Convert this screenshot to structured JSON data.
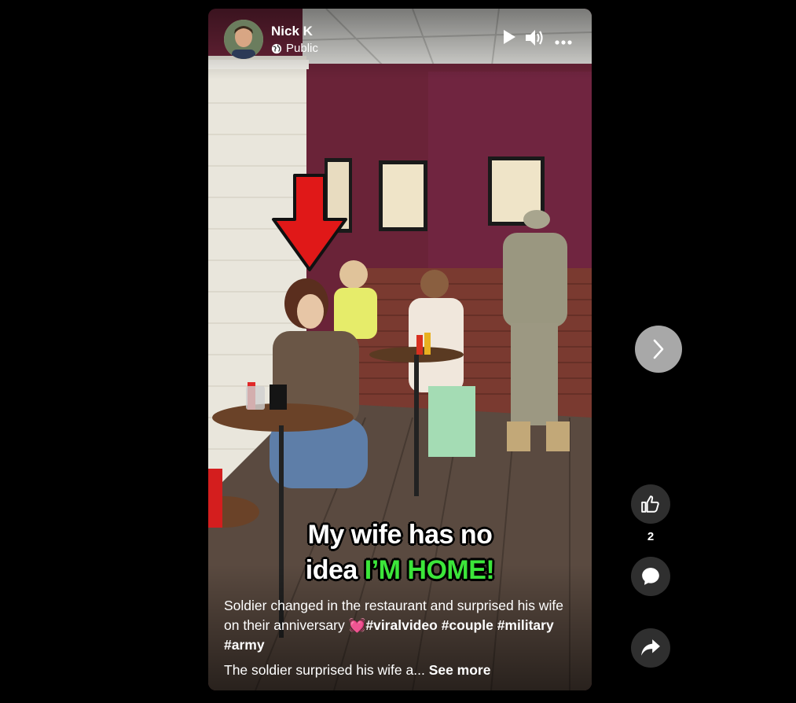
{
  "post": {
    "author": "Nick K",
    "privacy": "Public"
  },
  "video": {
    "caption_line1": "My wife has no",
    "caption_line2_plain": "idea ",
    "caption_line2_highlight": "I’M HOME!",
    "description_text": "Soldier changed in the restaurant and surprised his wife on their anniversary ",
    "emoji": "💓",
    "hashtags": [
      "#viralvideo",
      "#couple",
      "#military",
      "#army"
    ],
    "subtitle": "The soldier surprised his wife a...",
    "see_more": "See more"
  },
  "actions": {
    "like_count": "2"
  },
  "icons": {
    "play": "play-icon",
    "volume": "volume-icon",
    "more": "more-icon",
    "globe": "globe-icon",
    "next": "chevron-right-icon",
    "like": "thumbs-up-icon",
    "comment": "comment-icon",
    "share": "share-icon"
  },
  "colors": {
    "highlight_green": "#3ce63a",
    "wall_maroon": "#6a2338"
  }
}
